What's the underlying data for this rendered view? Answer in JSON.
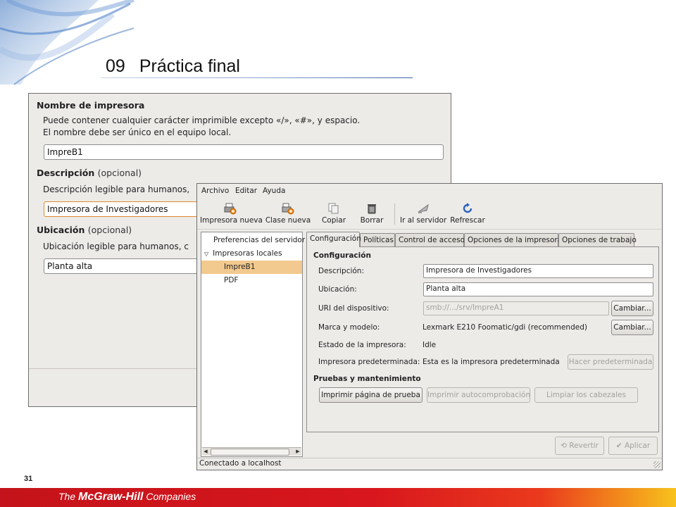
{
  "slide": {
    "number": "09",
    "title": "Práctica final",
    "page_number": "31",
    "brand_prefix": "The ",
    "brand_name": "McGraw-Hill",
    "brand_suffix": " Companies",
    "rule_color": "#3b5ca8",
    "footer_color": "#d8161d"
  },
  "back_dialog": {
    "name_section": {
      "title": "Nombre de impresora",
      "line1": "Puede contener cualquier carácter imprimible excepto «/», «#», y espacio.",
      "line2": "El nombre debe ser único en el equipo local.",
      "value": "ImpreB1"
    },
    "desc_section": {
      "title": "Descripción",
      "optional": "(opcional)",
      "help": "Descripción legible para humanos,",
      "value": "Impresora de Investigadores"
    },
    "loc_section": {
      "title": "Ubicación",
      "optional": "(opcional)",
      "help": "Ubicación legible para humanos, c",
      "value": "Planta alta"
    }
  },
  "window": {
    "menu": [
      "Archivo",
      "Editar",
      "Ayuda"
    ],
    "toolbar": {
      "new_printer": "Impresora nueva",
      "new_class": "Clase nueva",
      "copy": "Copiar",
      "delete": "Borrar",
      "goto_server": "Ir al servidor",
      "refresh": "Refrescar"
    },
    "tree": {
      "server_prefs": "Preferencias del servidor",
      "local_printers": "Impresoras locales",
      "printer_1": "ImpreB1",
      "printer_2": "PDF"
    },
    "tabs": [
      "Configuración",
      "Políticas",
      "Control de acceso",
      "Opciones de la impresora",
      "Opciones de trabajo"
    ],
    "config": {
      "section_title": "Configuración",
      "desc_label": "Descripción:",
      "desc_value": "Impresora de Investigadores",
      "loc_label": "Ubicación:",
      "loc_value": "Planta alta",
      "uri_label": "URI del dispositivo:",
      "uri_value": "smb://.../srv/ImpreA1",
      "change_label": "Cambiar...",
      "make_label": "Marca y modelo:",
      "make_value": "Lexmark E210 Foomatic/gdi (recommended)",
      "state_label": "Estado de la impresora:",
      "state_value": "Idle",
      "default_label": "Impresora predeterminada:",
      "default_value": "Esta es la impresora predeterminada",
      "make_default": "Hacer predeterminada"
    },
    "maintenance": {
      "section_title": "Pruebas y mantenimiento",
      "print_test": "Imprimir página de prueba",
      "self_test": "Imprimir autocomprobación",
      "clean_heads": "Limpiar los cabezales"
    },
    "revert": "Revertir",
    "apply": "Aplicar",
    "status": "Conectado a localhost",
    "selection_color": "#f2c98e",
    "icons": [
      "printer-new-icon",
      "class-new-icon",
      "copy-icon",
      "delete-icon",
      "goto-server-icon",
      "refresh-icon"
    ]
  }
}
